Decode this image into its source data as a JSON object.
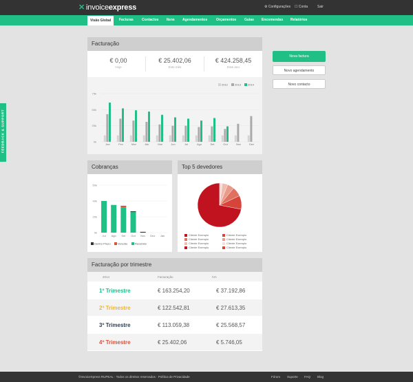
{
  "brand": {
    "logo_prefix": "invoice",
    "logo_bold": "express",
    "accent": "#1fbf86",
    "dark": "#333333"
  },
  "top_links": {
    "settings": "Configurações",
    "account": "Conta",
    "logout": "Sair"
  },
  "nav": [
    "Visão Global",
    "Facturas",
    "Contactos",
    "Itens",
    "Agendamentos",
    "Orçamentos",
    "Guias",
    "Encomendas",
    "Relatórios"
  ],
  "feedback": "FEEDBACK & SUPPORT",
  "billing": {
    "title": "Facturação",
    "kpis": [
      {
        "value": "€ 0,00",
        "label": "Hoje"
      },
      {
        "value": "€ 25.402,06",
        "label": "Este mês"
      },
      {
        "value": "€ 424.258,45",
        "label": "Este ano"
      }
    ]
  },
  "actions": {
    "new_invoice": "Nova factura",
    "new_schedule": "Novo agendamento",
    "new_contact": "Novo contacto"
  },
  "collections": {
    "title": "Cobranças"
  },
  "debtors": {
    "title": "Top 5 devedores",
    "legend": [
      "Cliente Exemplo",
      "Cliente Exemplo",
      "Cliente Exemplo",
      "Cliente Exemplo",
      "Cliente Exemplo",
      "Cliente Exemplo",
      "Cliente Exemplo",
      "Cliente Exemplo"
    ]
  },
  "quarterly": {
    "title": "Facturação por trimestre",
    "headers": [
      "2014",
      "Facturação",
      "IVA"
    ],
    "rows": [
      {
        "label": "1º Trimestre",
        "billing": "€ 163.254,20",
        "vat": "€ 37.192,86",
        "color": "#1fbf86"
      },
      {
        "label": "2º Trimestre",
        "billing": "€ 122.542,81",
        "vat": "€ 27.613,35",
        "color": "#e8b640"
      },
      {
        "label": "3º Trimestre",
        "billing": "€ 113.059,38",
        "vat": "€ 25.568,57",
        "color": "#2f3e4f"
      },
      {
        "label": "4º Trimestre",
        "billing": "€ 25.402,06",
        "vat": "€ 5.746,05",
        "color": "#d9533c"
      }
    ]
  },
  "footer": {
    "copyright": "©InvoiceXpress RUPEAL · Todos os direitos reservados · Política de Privacidade",
    "links": [
      "Fórum",
      "Suporte",
      "FAQ",
      "Blog"
    ]
  },
  "chart_data": [
    {
      "type": "bar",
      "categories": [
        "Jan",
        "Fev",
        "Mar",
        "Abr",
        "Mai",
        "Jun",
        "Jul",
        "Ago",
        "Set",
        "Out",
        "Nov",
        "Dez"
      ],
      "series": [
        {
          "name": "2012",
          "values": [
            10,
            10,
            10,
            10,
            10,
            10,
            10,
            10,
            10,
            10,
            10,
            10
          ],
          "color": "#d4d4d4"
        },
        {
          "name": "2013",
          "values": [
            43,
            36,
            33,
            31,
            27,
            25,
            25,
            23,
            24,
            20,
            28,
            40
          ],
          "color": "#aaaaaa"
        },
        {
          "name": "2014",
          "values": [
            61,
            52,
            49,
            47,
            42,
            38,
            36,
            33,
            37,
            24,
            0,
            0
          ],
          "color": "#1fbf86"
        }
      ],
      "yticks": [
        "0k",
        "25k",
        "50k",
        "75k"
      ],
      "ylim": [
        0,
        75
      ],
      "legend": "top-right"
    },
    {
      "type": "bar",
      "stacked": true,
      "categories": [
        "Jul",
        "Ago",
        "Set",
        "Out",
        "Nov",
        "Dez",
        "Jan"
      ],
      "series": [
        {
          "name": "Dentro Prazo",
          "values": [
            0,
            0,
            0,
            1,
            1,
            0,
            0
          ],
          "color": "#333333"
        },
        {
          "name": "Vencido",
          "values": [
            0,
            0,
            2,
            0,
            0,
            0,
            0
          ],
          "color": "#d9533c"
        },
        {
          "name": "Recebido",
          "values": [
            40,
            35,
            32,
            26,
            0,
            0,
            0
          ],
          "color": "#1fbf86"
        }
      ],
      "yticks": [
        "0k",
        "20k",
        "40k",
        "60k"
      ],
      "ylim": [
        0,
        60
      ],
      "legend": "bottom"
    },
    {
      "type": "pie",
      "values": [
        72,
        10,
        7,
        5,
        4,
        2
      ],
      "colors": [
        "#c1121f",
        "#d7443a",
        "#e07060",
        "#e99a88",
        "#f0bcb0",
        "#f6ddd6"
      ]
    }
  ]
}
